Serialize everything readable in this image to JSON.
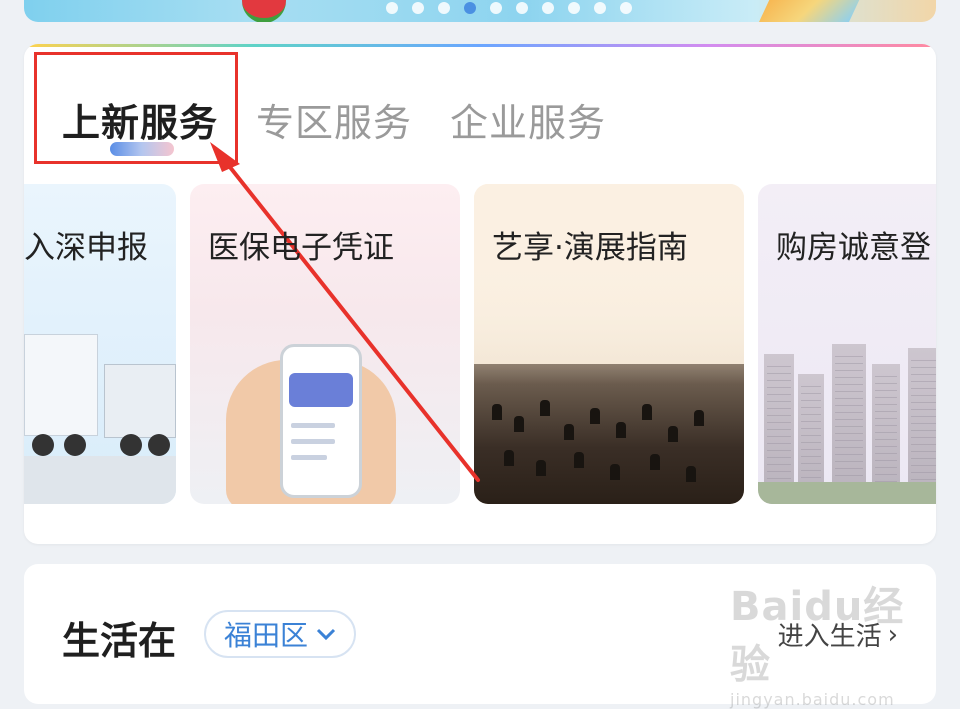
{
  "banner": {
    "page_dots": 10,
    "active_dot": 3
  },
  "service_card": {
    "tabs": [
      {
        "label": "上新服务",
        "active": true
      },
      {
        "label": "专区服务",
        "active": false
      },
      {
        "label": "企业服务",
        "active": false
      }
    ],
    "tiles": [
      {
        "title": "入深申报",
        "image": "truck"
      },
      {
        "title": "医保电子凭证",
        "image": "phone-in-hand"
      },
      {
        "title": "艺享·演展指南",
        "image": "orchestra"
      },
      {
        "title": "购房诚意登",
        "image": "apartment-buildings"
      }
    ]
  },
  "life_card": {
    "title": "生活在",
    "district": "福田区",
    "enter_link": "进入生活",
    "chevron": "›"
  },
  "watermark": {
    "brand": "Baidu经验",
    "url": "jingyan.baidu.com"
  },
  "colors": {
    "annotation_red": "#e8322b",
    "accent_blue": "#3b82d6"
  }
}
